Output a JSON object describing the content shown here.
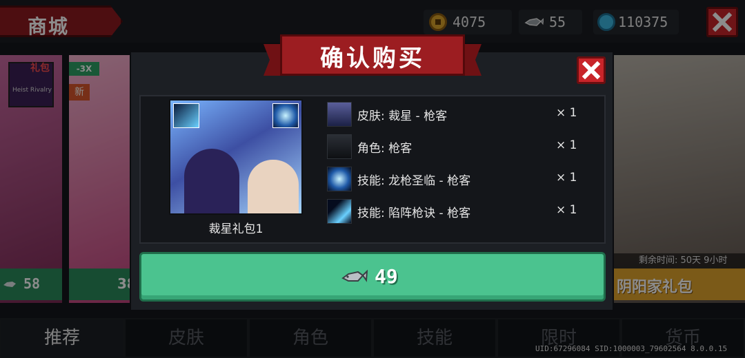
{
  "header": {
    "title": "商城",
    "coins": "4075",
    "fish": "55",
    "gems": "110375"
  },
  "background_cards": {
    "left_pack_tag": "礼包",
    "left_pack_thumb_text": "Heist Rivalry",
    "discount_tag": "-3X",
    "new_tag": "新",
    "left_price": "58",
    "left2_price": "38",
    "remaining_time": "剩余时间: 50天 9小时",
    "right_pack_name": "阴阳家礼包"
  },
  "dialog": {
    "title": "确认购买",
    "pack_name": "裁星礼包1",
    "items": [
      {
        "label": "皮肤: 裁星 - 枪客",
        "qty": "× 1",
        "icon": "skin-icon"
      },
      {
        "label": "角色: 枪客",
        "qty": "× 1",
        "icon": "character-icon"
      },
      {
        "label": "技能: 龙枪圣临 - 枪客",
        "qty": "× 1",
        "icon": "skill-icon"
      },
      {
        "label": "技能: 陷阵枪诀 - 枪客",
        "qty": "× 1",
        "icon": "skill-icon"
      }
    ],
    "price": "49",
    "price_icon": "fish-icon"
  },
  "tabs": [
    {
      "label": "推荐",
      "active": true
    },
    {
      "label": "皮肤",
      "active": false
    },
    {
      "label": "角色",
      "active": false
    },
    {
      "label": "技能",
      "active": false
    },
    {
      "label": "限时",
      "active": false
    },
    {
      "label": "货币",
      "active": false
    }
  ],
  "footer": {
    "uid": "UID:67296084 SID:1000003_79602564 8.0.0.15"
  },
  "colors": {
    "accent_red": "#c8252a",
    "buy_green": "#4bc38f",
    "ribbon_red": "#9c1d21",
    "gold": "#e0a52d"
  }
}
